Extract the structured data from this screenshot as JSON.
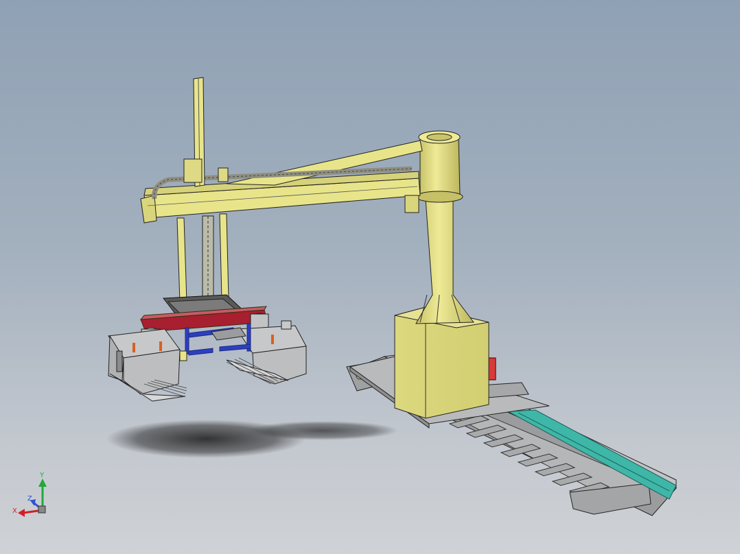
{
  "axes": {
    "x_label": "X",
    "y_label": "Y",
    "z_label": "Z"
  },
  "colors": {
    "background_top": "#8fa1b4",
    "background_bottom": "#cfd2d6",
    "column_yellow": "#e8e48a",
    "rail_gray": "#b4b6b8",
    "accent_red": "#a81f2f",
    "accent_blue": "#2d3fc0",
    "rail_cyan": "#3fb7a8",
    "axis_x": "#d0202a",
    "axis_y": "#22a83a",
    "axis_z": "#3050d0"
  }
}
